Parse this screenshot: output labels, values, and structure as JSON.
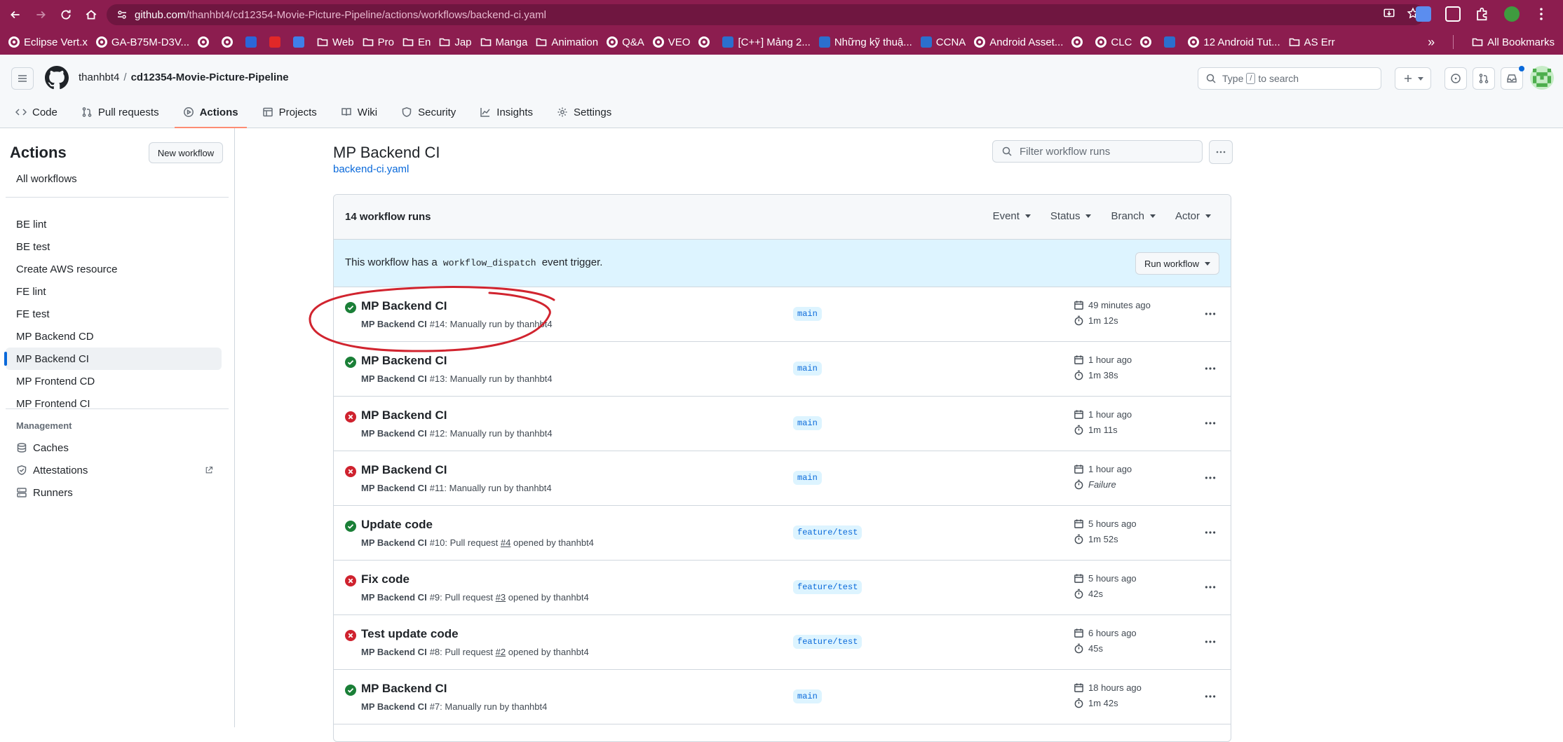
{
  "browser": {
    "url_host": "github.com",
    "url_path": "/thanhbt4/cd12354-Movie-Picture-Pipeline/actions/workflows/backend-ci.yaml",
    "accent_color": "#8c1d4f"
  },
  "bookmarks": {
    "items": [
      {
        "label": "Eclipse Vert.x",
        "icon": "chrome-icon"
      },
      {
        "label": "GA-B75M-D3V...",
        "icon": "globe-icon"
      },
      {
        "label": "",
        "icon": "globe-icon"
      },
      {
        "label": "",
        "icon": "globe-icon"
      },
      {
        "label": "",
        "icon": "o365-icon"
      },
      {
        "label": "",
        "icon": "flipboard-icon"
      },
      {
        "label": "",
        "icon": "translate-icon"
      },
      {
        "label": "Web",
        "icon": "folder-icon"
      },
      {
        "label": "Pro",
        "icon": "folder-icon"
      },
      {
        "label": "En",
        "icon": "folder-icon"
      },
      {
        "label": "Jap",
        "icon": "folder-icon"
      },
      {
        "label": "Manga",
        "icon": "folder-icon"
      },
      {
        "label": "Animation",
        "icon": "folder-icon"
      },
      {
        "label": "Q&A",
        "icon": "globe-icon"
      },
      {
        "label": "VEO",
        "icon": "globe-icon"
      },
      {
        "label": "",
        "icon": "globe-icon"
      },
      {
        "label": "[C++] Mảng 2...",
        "icon": "page-icon"
      },
      {
        "label": "Những kỹ thuậ...",
        "icon": "page-icon"
      },
      {
        "label": "CCNA",
        "icon": "page-icon"
      },
      {
        "label": "Android Asset...",
        "icon": "globe-icon"
      },
      {
        "label": "",
        "icon": "globe-icon"
      },
      {
        "label": "CLC",
        "icon": "globe-icon"
      },
      {
        "label": "",
        "icon": "globe-icon"
      },
      {
        "label": "",
        "icon": "page-icon"
      },
      {
        "label": "12 Android Tut...",
        "icon": "globe-icon"
      },
      {
        "label": "AS Err",
        "icon": "folder-icon"
      }
    ],
    "more_label": "»",
    "all_bookmarks_label": "All Bookmarks"
  },
  "header": {
    "owner": "thanhbt4",
    "separator": "/",
    "repo": "cd12354-Movie-Picture-Pipeline",
    "search_prefix": "Type",
    "search_key": "/",
    "search_suffix": "to search"
  },
  "repo_tabs": [
    {
      "label": "Code",
      "icon": "code-icon"
    },
    {
      "label": "Pull requests",
      "icon": "pull-request-icon"
    },
    {
      "label": "Actions",
      "icon": "play-icon"
    },
    {
      "label": "Projects",
      "icon": "table-icon"
    },
    {
      "label": "Wiki",
      "icon": "book-icon"
    },
    {
      "label": "Security",
      "icon": "shield-icon"
    },
    {
      "label": "Insights",
      "icon": "graph-icon"
    },
    {
      "label": "Settings",
      "icon": "gear-icon"
    }
  ],
  "sidebar": {
    "title": "Actions",
    "new_workflow": "New workflow",
    "all_workflows": "All workflows",
    "workflows": [
      "BE lint",
      "BE test",
      "Create AWS resource",
      "FE lint",
      "FE test",
      "MP Backend CD",
      "MP Backend CI",
      "MP Frontend CD",
      "MP Frontend CI"
    ],
    "active_workflow": "MP Backend CI",
    "management_label": "Management",
    "management": [
      {
        "label": "Caches",
        "icon": "cache-icon"
      },
      {
        "label": "Attestations",
        "icon": "shield-check-icon"
      },
      {
        "label": "Runners",
        "icon": "server-icon"
      }
    ]
  },
  "main": {
    "title": "MP Backend CI",
    "file": "backend-ci.yaml",
    "filter_placeholder": "Filter workflow runs",
    "runs_count": "14 workflow runs",
    "filters": [
      "Event",
      "Status",
      "Branch",
      "Actor"
    ],
    "dispatch_prefix": "This workflow has a",
    "dispatch_code": "workflow_dispatch",
    "dispatch_suffix": "event trigger.",
    "run_workflow": "Run workflow"
  },
  "runs": [
    {
      "title": "MP Backend CI",
      "workflow": "MP Backend CI",
      "number": "#14",
      "desc": ": Manually run by thanhbt4",
      "branch": "main",
      "time": "49 minutes ago",
      "duration": "1m 12s",
      "status": "success"
    },
    {
      "title": "MP Backend CI",
      "workflow": "MP Backend CI",
      "number": "#13",
      "desc": ": Manually run by thanhbt4",
      "branch": "main",
      "time": "1 hour ago",
      "duration": "1m 38s",
      "status": "success"
    },
    {
      "title": "MP Backend CI",
      "workflow": "MP Backend CI",
      "number": "#12",
      "desc": ": Manually run by thanhbt4",
      "branch": "main",
      "time": "1 hour ago",
      "duration": "1m 11s",
      "status": "failure"
    },
    {
      "title": "MP Backend CI",
      "workflow": "MP Backend CI",
      "number": "#11",
      "desc": ": Manually run by thanhbt4",
      "branch": "main",
      "time": "1 hour ago",
      "duration": "Failure",
      "status": "failure"
    },
    {
      "title": "Update code",
      "workflow": "MP Backend CI",
      "number": "#10",
      "desc_pre": ": Pull request ",
      "pr": "#4",
      "desc_post": " opened by thanhbt4",
      "branch": "feature/test",
      "time": "5 hours ago",
      "duration": "1m 52s",
      "status": "success"
    },
    {
      "title": "Fix code",
      "workflow": "MP Backend CI",
      "number": "#9",
      "desc_pre": ": Pull request ",
      "pr": "#3",
      "desc_post": " opened by thanhbt4",
      "branch": "feature/test",
      "time": "5 hours ago",
      "duration": "42s",
      "status": "failure"
    },
    {
      "title": "Test update code",
      "workflow": "MP Backend CI",
      "number": "#8",
      "desc_pre": ": Pull request ",
      "pr": "#2",
      "desc_post": " opened by thanhbt4",
      "branch": "feature/test",
      "time": "6 hours ago",
      "duration": "45s",
      "status": "failure"
    },
    {
      "title": "MP Backend CI",
      "workflow": "MP Backend CI",
      "number": "#7",
      "desc": ": Manually run by thanhbt4",
      "branch": "main",
      "time": "18 hours ago",
      "duration": "1m 42s",
      "status": "success"
    }
  ],
  "colors": {
    "success": "#1a7f37",
    "failure": "#cf222e",
    "annotation": "#d1242f",
    "link": "#0969da"
  }
}
